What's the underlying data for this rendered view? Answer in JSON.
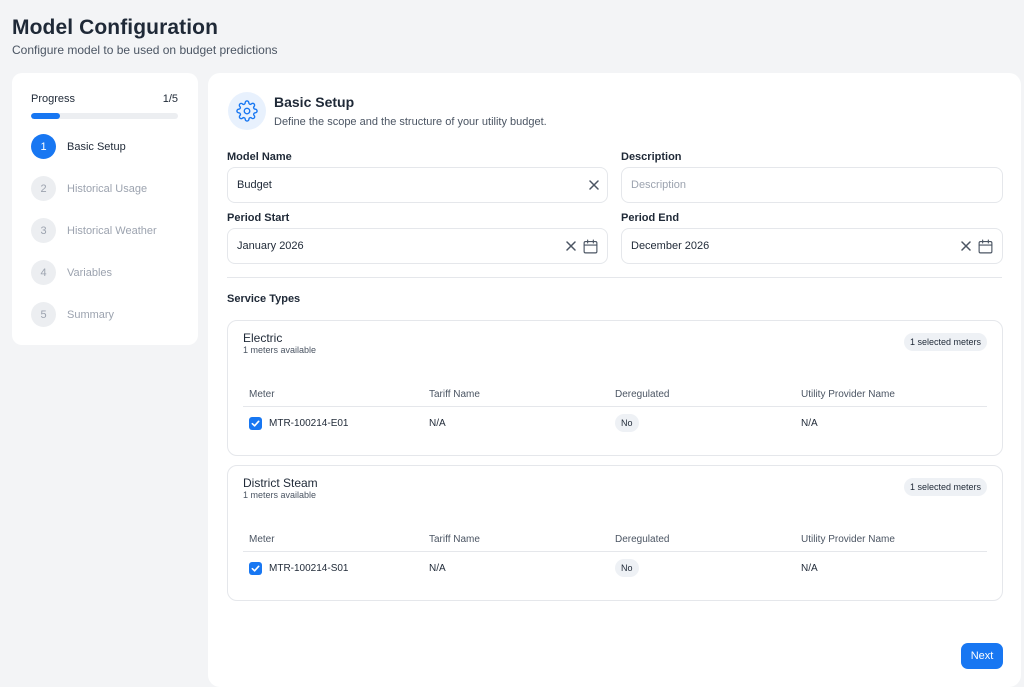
{
  "header": {
    "title": "Model Configuration",
    "subtitle": "Configure model to be used on budget predictions"
  },
  "progress": {
    "label": "Progress",
    "count": "1/5",
    "fraction": 0.2,
    "steps": [
      {
        "num": "1",
        "label": "Basic Setup",
        "active": true
      },
      {
        "num": "2",
        "label": "Historical Usage",
        "active": false
      },
      {
        "num": "3",
        "label": "Historical Weather",
        "active": false
      },
      {
        "num": "4",
        "label": "Variables",
        "active": false
      },
      {
        "num": "5",
        "label": "Summary",
        "active": false
      }
    ]
  },
  "section": {
    "icon": "gear-icon",
    "title": "Basic Setup",
    "description": "Define the scope and the structure of your utility budget."
  },
  "form": {
    "model_name": {
      "label": "Model Name",
      "value": "Budget"
    },
    "description": {
      "label": "Description",
      "value": "",
      "placeholder": "Description"
    },
    "period_start": {
      "label": "Period Start",
      "value": "January 2026"
    },
    "period_end": {
      "label": "Period End",
      "value": "December 2026"
    }
  },
  "service_types": {
    "label": "Service Types",
    "columns": [
      "Meter",
      "Tariff Name",
      "Deregulated",
      "Utility Provider Name"
    ],
    "services": [
      {
        "name": "Electric",
        "available": "1 meters available",
        "badge": "1 selected meters",
        "meters": [
          {
            "meter": "MTR-100214-E01",
            "tariff": "N/A",
            "deregulated": "No",
            "provider": "N/A",
            "checked": true
          }
        ]
      },
      {
        "name": "District Steam",
        "available": "1 meters available",
        "badge": "1 selected meters",
        "meters": [
          {
            "meter": "MTR-100214-S01",
            "tariff": "N/A",
            "deregulated": "No",
            "provider": "N/A",
            "checked": true
          }
        ]
      }
    ]
  },
  "actions": {
    "next_label": "Next"
  },
  "colors": {
    "accent": "#1877f2",
    "background": "#f3f4f6"
  }
}
